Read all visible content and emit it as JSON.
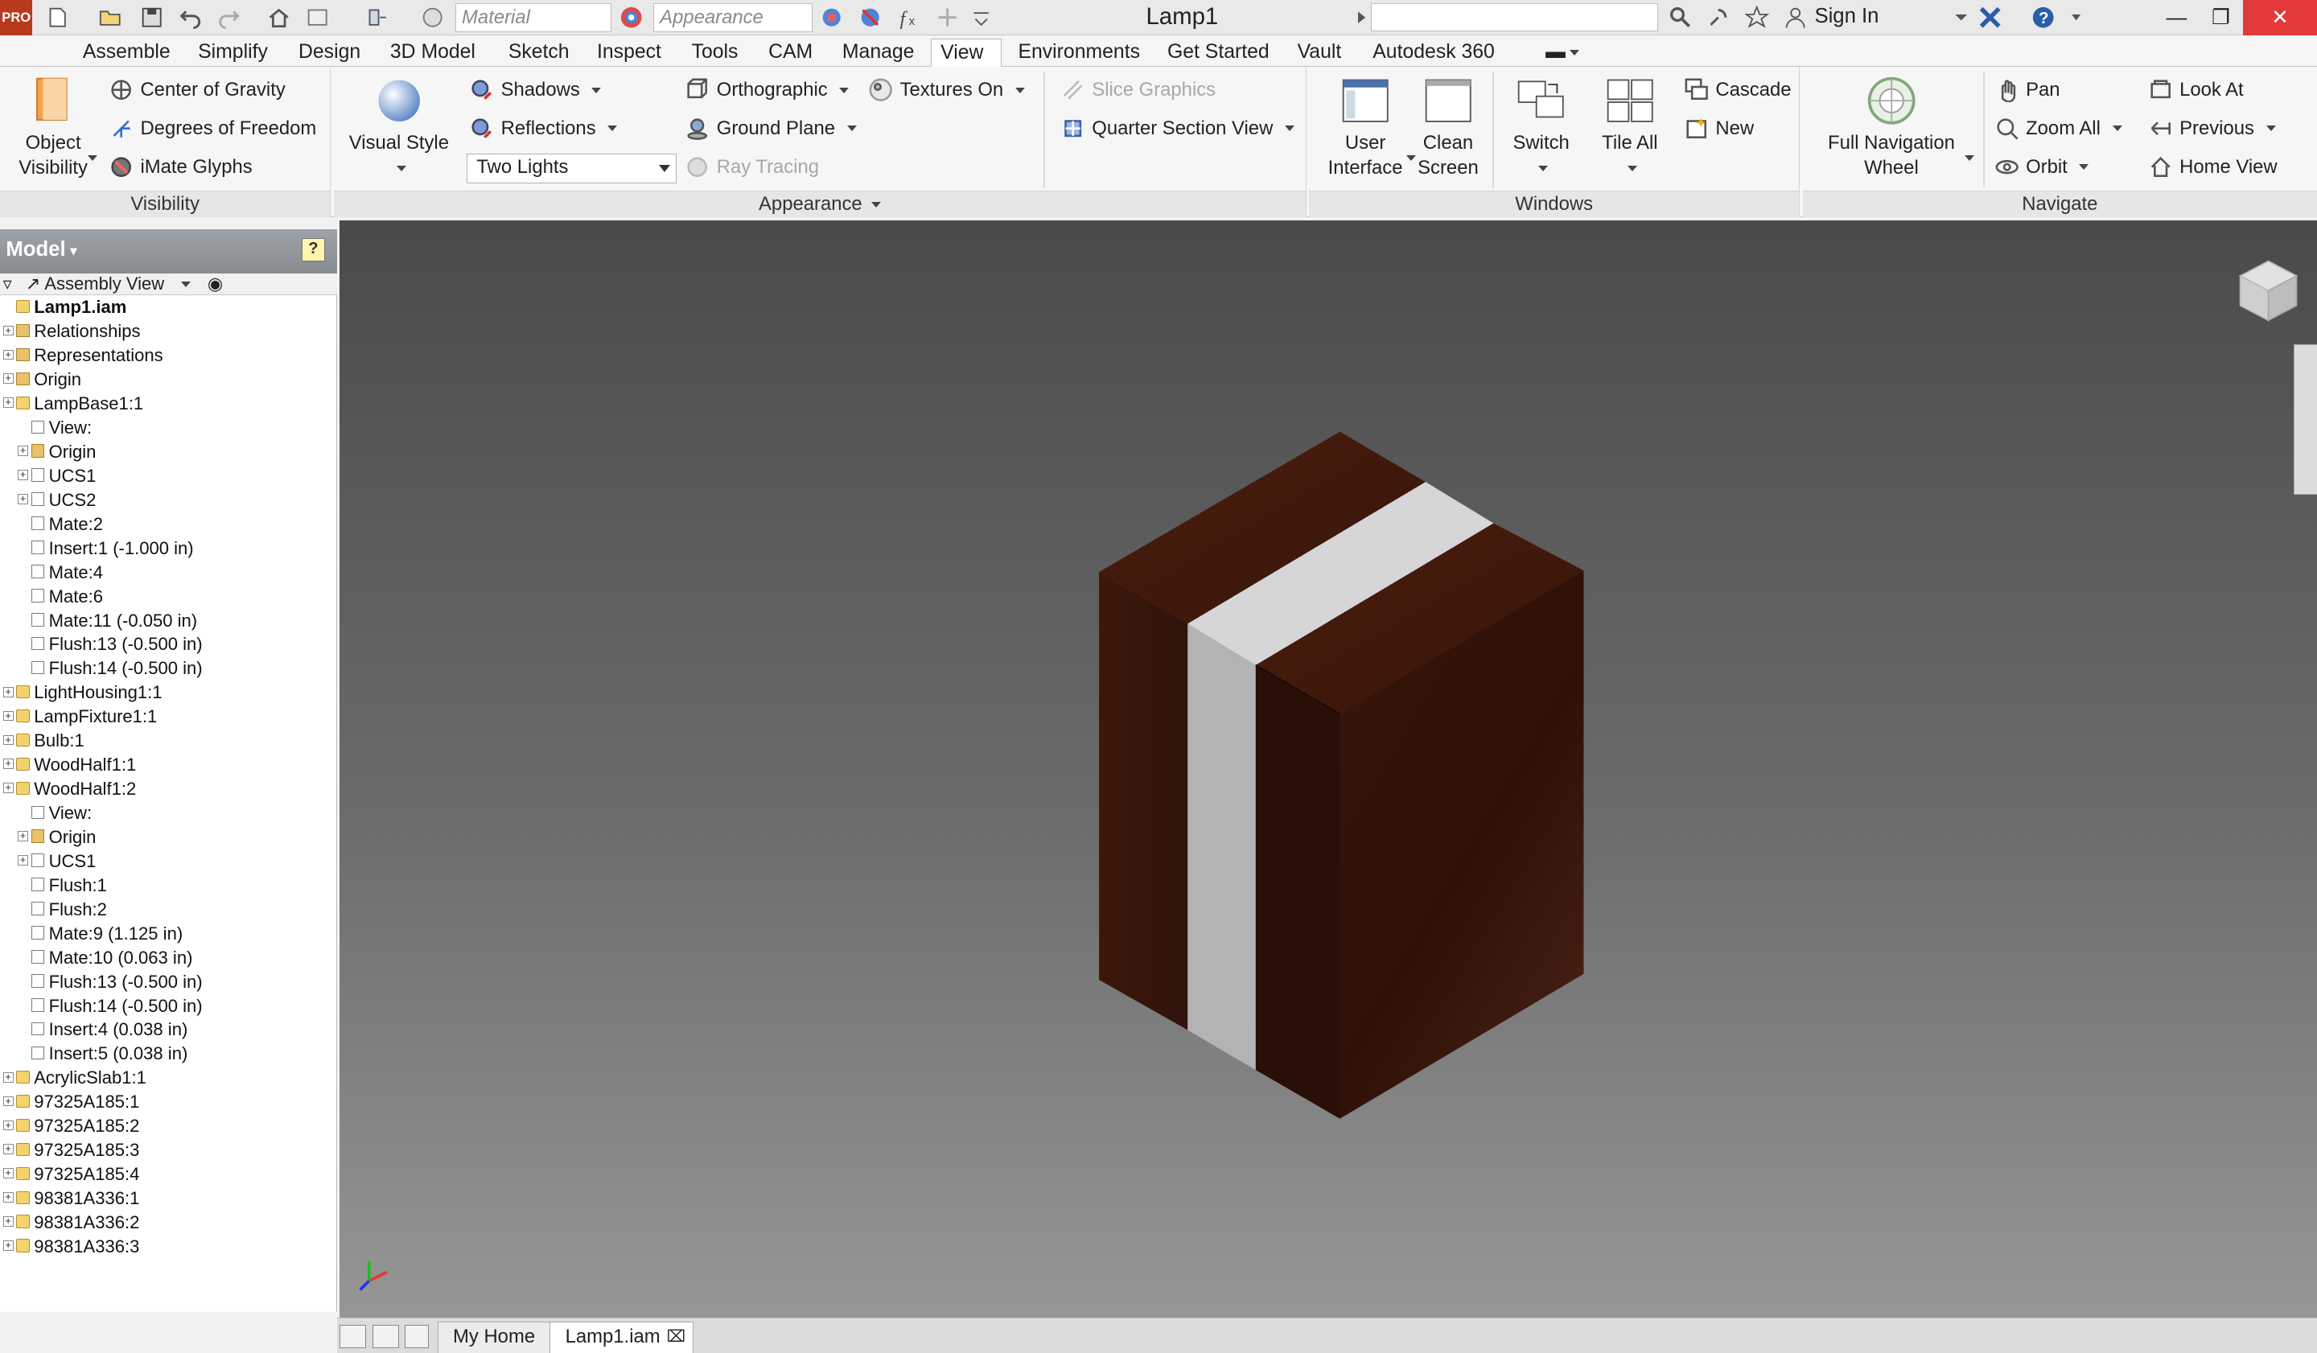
{
  "app": {
    "logo_text": "PRO",
    "document_title": "Lamp1",
    "signin_label": "Sign In"
  },
  "quick_access": {
    "material_placeholder": "Material",
    "appearance_placeholder": "Appearance"
  },
  "menu_tabs": [
    "Assemble",
    "Simplify",
    "Design",
    "3D Model",
    "Sketch",
    "Inspect",
    "Tools",
    "CAM",
    "Manage",
    "View",
    "Environments",
    "Get Started",
    "Vault",
    "Autodesk 360"
  ],
  "active_tab": "View",
  "ribbon": {
    "visibility": {
      "title": "Visibility",
      "object_visibility": "Object\nVisibility",
      "center_of_gravity": "Center of Gravity",
      "degrees_of_freedom": "Degrees of Freedom",
      "imate_glyphs": "iMate Glyphs"
    },
    "appearance": {
      "title": "Appearance",
      "visual_style": "Visual Style",
      "shadows": "Shadows",
      "reflections": "Reflections",
      "lights_value": "Two Lights",
      "orthographic": "Orthographic",
      "ground_plane": "Ground Plane",
      "ray_tracing": "Ray Tracing",
      "textures_on": "Textures On",
      "slice_graphics": "Slice Graphics",
      "quarter_section_view": "Quarter Section View"
    },
    "windows": {
      "title": "Windows",
      "user_interface": "User\nInterface",
      "clean_screen": "Clean\nScreen",
      "switch": "Switch",
      "tile_all": "Tile All",
      "cascade": "Cascade",
      "new": "New"
    },
    "navigate": {
      "title": "Navigate",
      "full_navigation_wheel": "Full Navigation\nWheel",
      "pan": "Pan",
      "zoom_all": "Zoom All",
      "orbit": "Orbit",
      "look_at": "Look At",
      "previous": "Previous",
      "home_view": "Home View"
    }
  },
  "browser": {
    "title": "Model",
    "filter_label": "Assembly View",
    "help_label": "?",
    "tree": [
      {
        "label": "Lamp1.iam",
        "level": 0,
        "icon": "assembly",
        "bold": true
      },
      {
        "label": "Relationships",
        "level": 0,
        "icon": "folder",
        "expander": true
      },
      {
        "label": "Representations",
        "level": 0,
        "icon": "folder",
        "expander": true
      },
      {
        "label": "Origin",
        "level": 0,
        "icon": "folder",
        "expander": true
      },
      {
        "label": "LampBase1:1",
        "level": 0,
        "icon": "part",
        "expander": true
      },
      {
        "label": "View:",
        "level": 1,
        "icon": "view"
      },
      {
        "label": "Origin",
        "level": 1,
        "icon": "folder",
        "expander": true
      },
      {
        "label": "UCS1",
        "level": 1,
        "icon": "ucs",
        "expander": true
      },
      {
        "label": "UCS2",
        "level": 1,
        "icon": "ucs",
        "expander": true
      },
      {
        "label": "Mate:2",
        "level": 1,
        "icon": "mate"
      },
      {
        "label": "Insert:1 (-1.000 in)",
        "level": 1,
        "icon": "insert"
      },
      {
        "label": "Mate:4",
        "level": 1,
        "icon": "mate"
      },
      {
        "label": "Mate:6",
        "level": 1,
        "icon": "mate"
      },
      {
        "label": "Mate:11 (-0.050 in)",
        "level": 1,
        "icon": "mate"
      },
      {
        "label": "Flush:13 (-0.500 in)",
        "level": 1,
        "icon": "flush"
      },
      {
        "label": "Flush:14 (-0.500 in)",
        "level": 1,
        "icon": "flush"
      },
      {
        "label": "LightHousing1:1",
        "level": 0,
        "icon": "part",
        "expander": true
      },
      {
        "label": "LampFixture1:1",
        "level": 0,
        "icon": "part",
        "expander": true
      },
      {
        "label": "Bulb:1",
        "level": 0,
        "icon": "part",
        "expander": true
      },
      {
        "label": "WoodHalf1:1",
        "level": 0,
        "icon": "part",
        "expander": true
      },
      {
        "label": "WoodHalf1:2",
        "level": 0,
        "icon": "part",
        "expander": true
      },
      {
        "label": "View:",
        "level": 1,
        "icon": "view"
      },
      {
        "label": "Origin",
        "level": 1,
        "icon": "folder",
        "expander": true
      },
      {
        "label": "UCS1",
        "level": 1,
        "icon": "ucs",
        "expander": true
      },
      {
        "label": "Flush:1",
        "level": 1,
        "icon": "flush"
      },
      {
        "label": "Flush:2",
        "level": 1,
        "icon": "flush"
      },
      {
        "label": "Mate:9 (1.125 in)",
        "level": 1,
        "icon": "mate"
      },
      {
        "label": "Mate:10 (0.063 in)",
        "level": 1,
        "icon": "mate"
      },
      {
        "label": "Flush:13 (-0.500 in)",
        "level": 1,
        "icon": "flush"
      },
      {
        "label": "Flush:14 (-0.500 in)",
        "level": 1,
        "icon": "flush"
      },
      {
        "label": "Insert:4 (0.038 in)",
        "level": 1,
        "icon": "insert"
      },
      {
        "label": "Insert:5 (0.038 in)",
        "level": 1,
        "icon": "insert"
      },
      {
        "label": "AcrylicSlab1:1",
        "level": 0,
        "icon": "part",
        "expander": true
      },
      {
        "label": "97325A185:1",
        "level": 0,
        "icon": "part",
        "expander": true
      },
      {
        "label": "97325A185:2",
        "level": 0,
        "icon": "part",
        "expander": true
      },
      {
        "label": "97325A185:3",
        "level": 0,
        "icon": "part",
        "expander": true
      },
      {
        "label": "97325A185:4",
        "level": 0,
        "icon": "part",
        "expander": true
      },
      {
        "label": "98381A336:1",
        "level": 0,
        "icon": "part",
        "expander": true
      },
      {
        "label": "98381A336:2",
        "level": 0,
        "icon": "part",
        "expander": true
      },
      {
        "label": "98381A336:3",
        "level": 0,
        "icon": "part",
        "expander": true
      }
    ]
  },
  "doc_tabs": [
    {
      "label": "My Home",
      "active": false
    },
    {
      "label": "Lamp1.iam",
      "active": true
    }
  ],
  "colors": {
    "wood_top": "#3d1a0e",
    "wood_left": "#3a170c",
    "wood_right": "#2f1208",
    "acrylic_top": "#d6d6d8",
    "acrylic_side": "#b3b3b5",
    "accent_close": "#e23a3a"
  }
}
